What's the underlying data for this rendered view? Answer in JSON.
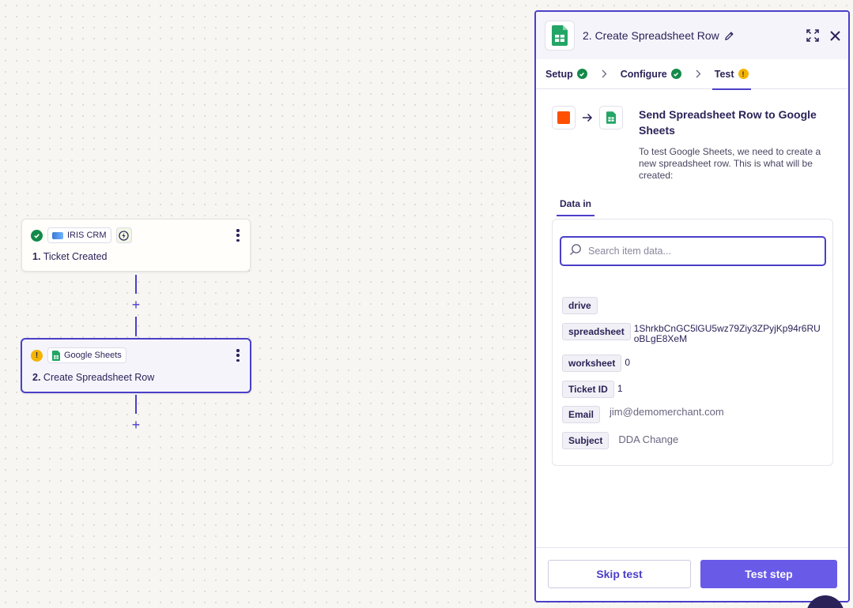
{
  "canvas": {
    "trigger_node": {
      "app_name": "IRIS CRM",
      "step_number": "1.",
      "title": "Ticket Created",
      "status": "ok"
    },
    "action_node": {
      "app_name": "Google Sheets",
      "step_number": "2.",
      "title": "Create Spreadsheet Row",
      "status": "warning"
    }
  },
  "panel": {
    "title": "2. Create Spreadsheet Row",
    "steps": [
      {
        "label": "Setup",
        "state": "complete"
      },
      {
        "label": "Configure",
        "state": "complete"
      },
      {
        "label": "Test",
        "state": "warning"
      }
    ],
    "send_title": "Send Spreadsheet Row to Google Sheets",
    "send_description": "To test Google Sheets, we need to create a new spreadsheet row. This is what will be created:",
    "data_tab": "Data in",
    "search_placeholder": "Search item data...",
    "fields": [
      {
        "key": "drive",
        "value": ""
      },
      {
        "key": "spreadsheet",
        "value": "1ShrkbCnGC5lGU5wz79Ziy3ZPyjKp94r6RUoBLgE8XeM"
      },
      {
        "key": "worksheet",
        "value": "0"
      },
      {
        "key": "Ticket ID",
        "value": "1"
      },
      {
        "key": "Email",
        "value": "jim@demomerchant.com"
      },
      {
        "key": "Subject",
        "value": "DDA Change"
      }
    ],
    "skip_label": "Skip test",
    "test_label": "Test step"
  },
  "colors": {
    "accent": "#4b3fc9",
    "primary_button": "#695be8",
    "success": "#138a4a",
    "warning": "#f4b400",
    "trigger_brand": "#ff4f00",
    "sheets_green": "#23a566"
  }
}
